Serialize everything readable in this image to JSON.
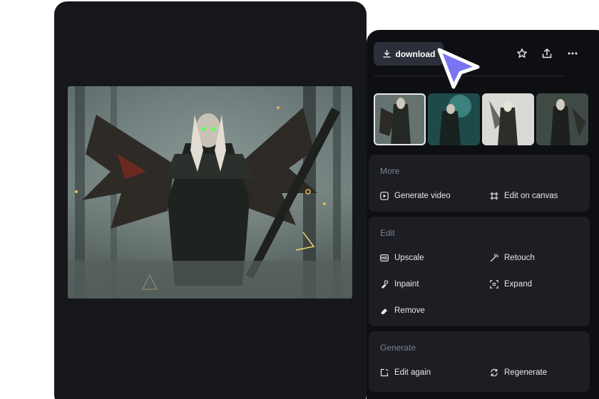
{
  "toolbar": {
    "download_label": "download",
    "icons": [
      "star-icon",
      "share-icon",
      "more-icon"
    ]
  },
  "thumbnails": {
    "count": 4,
    "selected_index": 0
  },
  "sections": {
    "more": {
      "title": "More",
      "actions": [
        {
          "label": "Generate video",
          "icon": "play-icon"
        },
        {
          "label": "Edit on canvas",
          "icon": "canvas-icon"
        }
      ]
    },
    "edit": {
      "title": "Edit",
      "actions": [
        {
          "label": "Upscale",
          "icon": "hd-icon"
        },
        {
          "label": "Retouch",
          "icon": "wand-icon"
        },
        {
          "label": "Inpaint",
          "icon": "inpaint-icon"
        },
        {
          "label": "Expand",
          "icon": "expand-icon"
        },
        {
          "label": "Remove",
          "icon": "eraser-icon"
        }
      ]
    },
    "generate": {
      "title": "Generate",
      "actions": [
        {
          "label": "Edit again",
          "icon": "edit-icon"
        },
        {
          "label": "Regenerate",
          "icon": "refresh-icon"
        }
      ]
    }
  },
  "colors": {
    "accent": "#7b74f0",
    "panel": "#0e0f12",
    "card": "#1d1e24"
  }
}
